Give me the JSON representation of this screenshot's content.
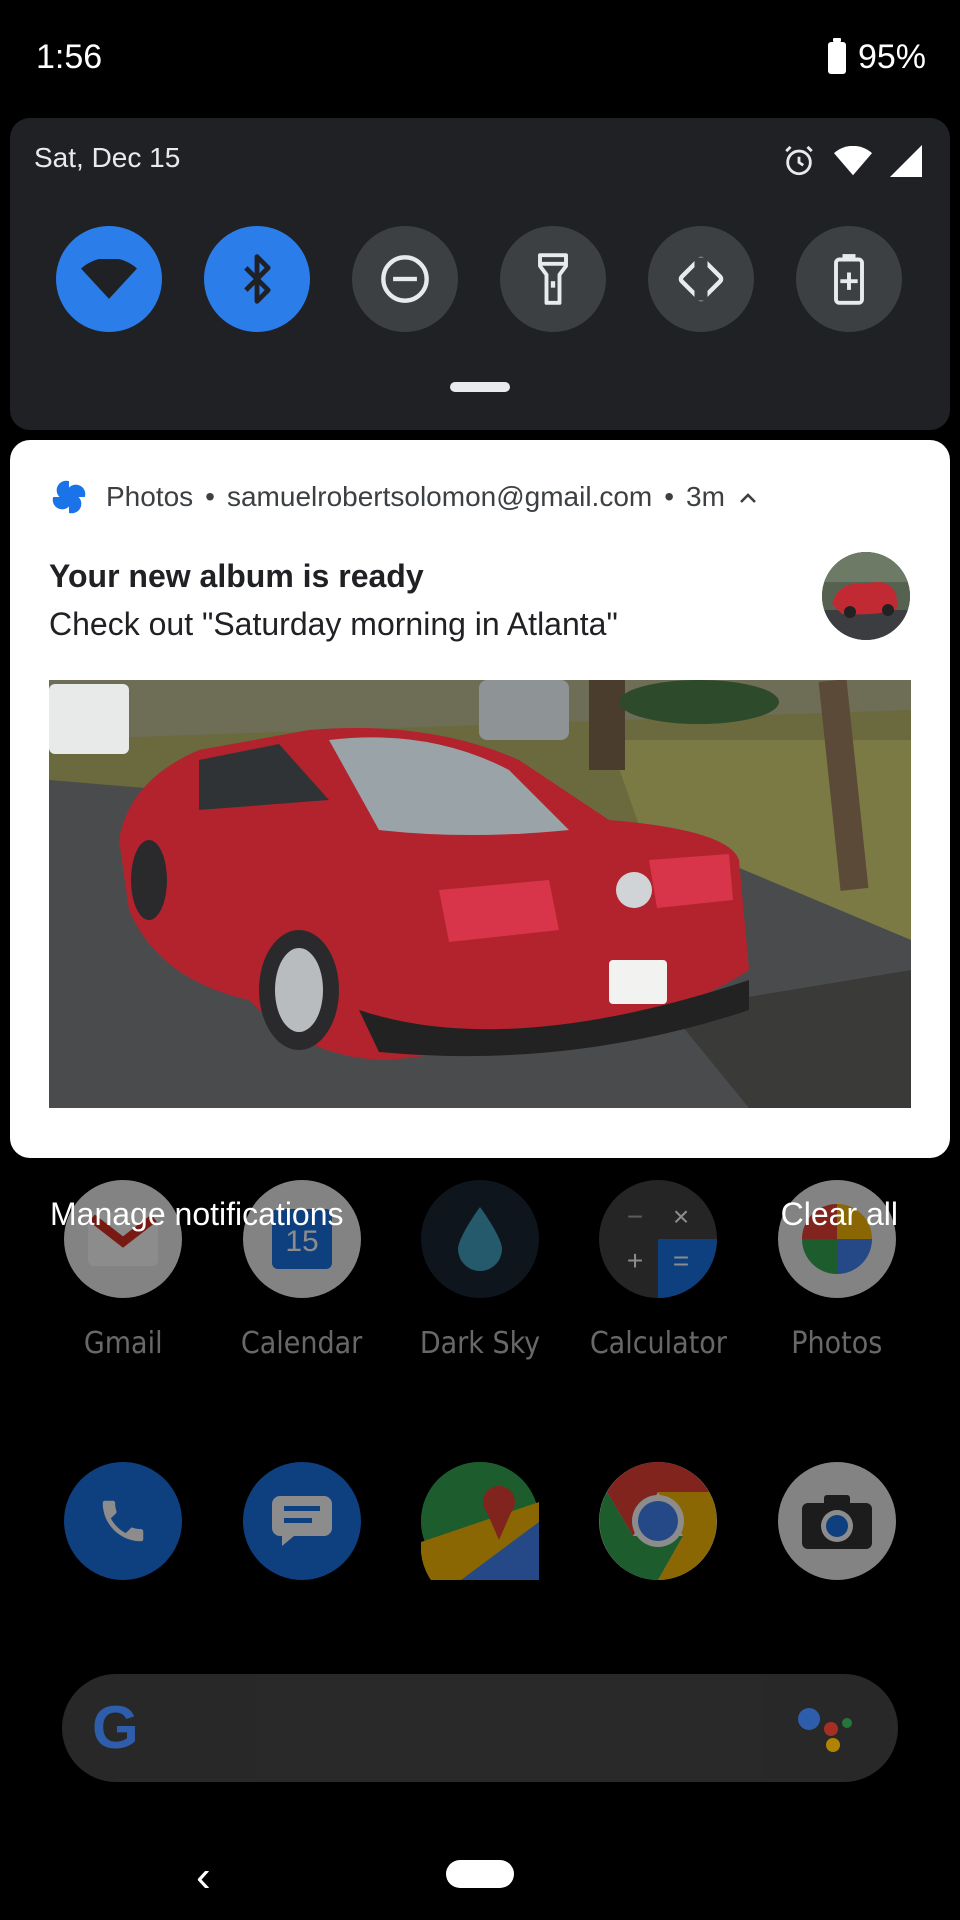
{
  "status_bar": {
    "time": "1:56",
    "battery": "95%"
  },
  "quick_settings": {
    "date": "Sat, Dec 15",
    "tiles": [
      {
        "name": "wifi-tile",
        "icon": "wifi-icon",
        "active": true
      },
      {
        "name": "bluetooth-tile",
        "icon": "bluetooth-icon",
        "active": true
      },
      {
        "name": "dnd-tile",
        "icon": "do-not-disturb-icon",
        "active": false
      },
      {
        "name": "flashlight-tile",
        "icon": "flashlight-icon",
        "active": false
      },
      {
        "name": "autorotate-tile",
        "icon": "rotate-icon",
        "active": false
      },
      {
        "name": "battery-saver-tile",
        "icon": "battery-saver-icon",
        "active": false
      }
    ],
    "accent": "#2b7de9"
  },
  "notification": {
    "app": "Photos",
    "account": "samuelrobertsolomon@gmail.com",
    "time_ago": "3m",
    "separator": "•",
    "title": "Your new album is ready",
    "text": "Check out \"Saturday morning in Atlanta\"",
    "image_description_icon": "photo-red-car"
  },
  "actions": {
    "manage": "Manage notifications",
    "clear": "Clear all"
  },
  "home": {
    "apps": [
      {
        "label": "Gmail",
        "icon": "gmail-icon"
      },
      {
        "label": "Calendar",
        "icon": "calendar-icon"
      },
      {
        "label": "Dark Sky",
        "icon": "dark-sky-icon"
      },
      {
        "label": "Calculator",
        "icon": "calculator-icon"
      },
      {
        "label": "Photos",
        "icon": "photos-icon"
      }
    ],
    "dock": [
      "phone-icon",
      "messages-icon",
      "maps-icon",
      "chrome-icon",
      "camera-icon"
    ]
  },
  "nav": {
    "back": "‹"
  }
}
